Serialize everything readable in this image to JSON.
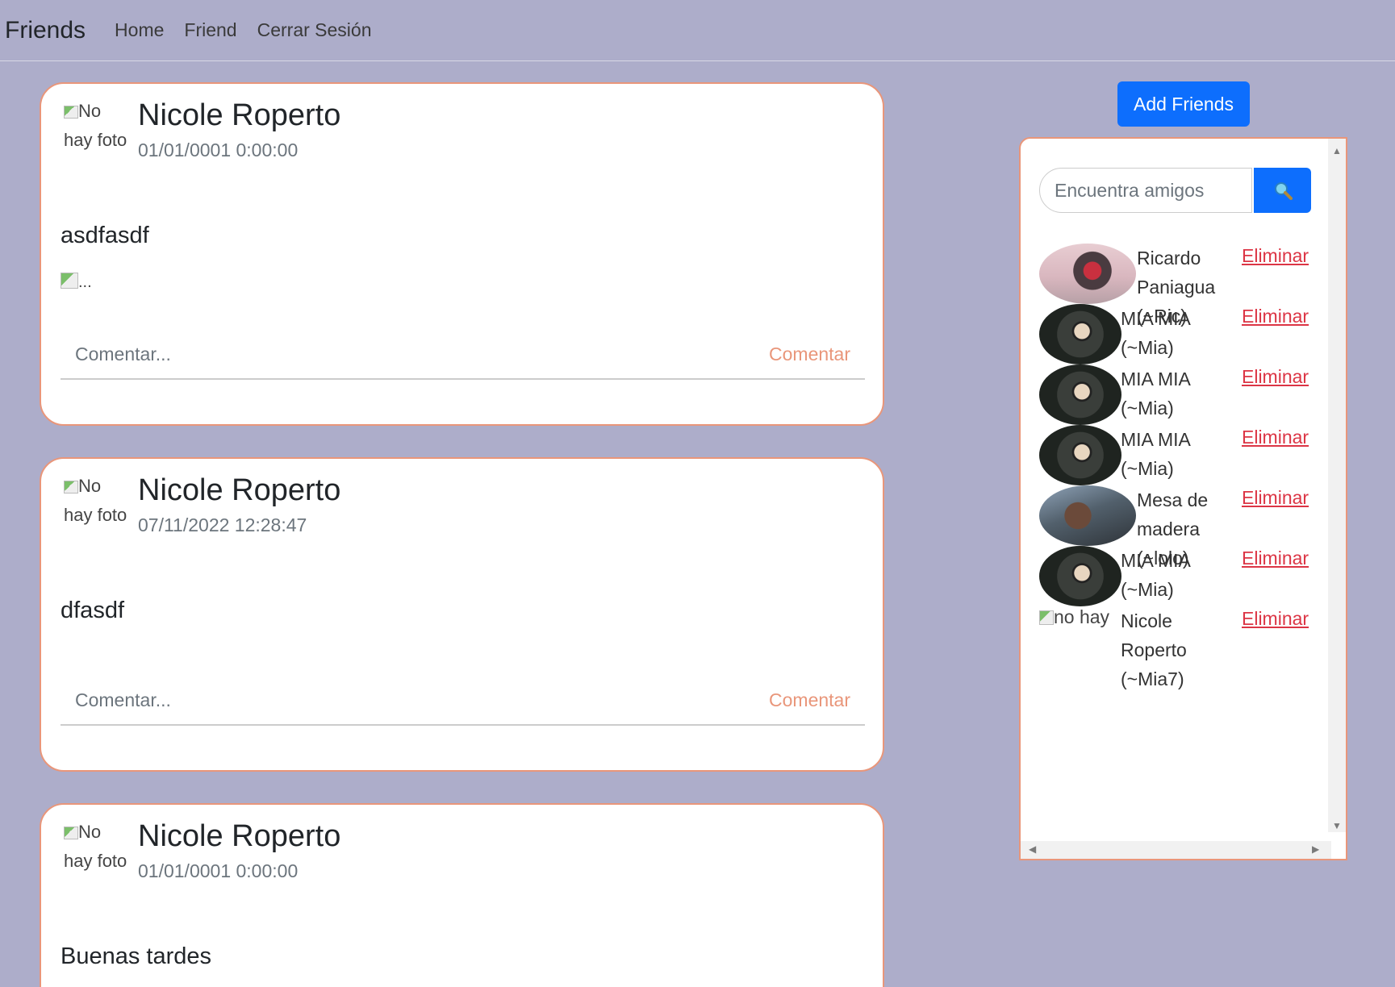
{
  "nav": {
    "brand": "Friends",
    "links": [
      "Home",
      "Friend",
      "Cerrar Sesión"
    ]
  },
  "posts": [
    {
      "avatar_alt": "No hay foto",
      "author": "Nicole Roperto",
      "date": "01/01/0001 0:00:00",
      "text": "asdfasdf",
      "image_alt": "...",
      "comment_placeholder": "Comentar...",
      "comment_button": "Comentar"
    },
    {
      "avatar_alt": "No hay foto",
      "author": "Nicole Roperto",
      "date": "07/11/2022 12:28:47",
      "text": "dfasdf",
      "comment_placeholder": "Comentar...",
      "comment_button": "Comentar"
    },
    {
      "avatar_alt": "No hay foto",
      "author": "Nicole Roperto",
      "date": "01/01/0001 0:00:00",
      "text": "Buenas tardes"
    }
  ],
  "sidebar": {
    "add_friends": "Add Friends",
    "search_placeholder": "Encuentra amigos",
    "search_icon": "magnifier-icon",
    "friends": [
      {
        "name": "Ricardo Paniagua (~Ric)",
        "remove": "Eliminar"
      },
      {
        "name": "MIA MIA (~Mia)",
        "remove": "Eliminar"
      },
      {
        "name": "MIA MIA (~Mia)",
        "remove": "Eliminar"
      },
      {
        "name": "MIA MIA (~Mia)",
        "remove": "Eliminar"
      },
      {
        "name": "Mesa de madera (~lolo)",
        "remove": "Eliminar"
      },
      {
        "name": "MIA MIA (~Mia)",
        "remove": "Eliminar"
      },
      {
        "name": "Nicole Roperto (~Mia7)",
        "remove": "Eliminar",
        "avatar_alt": "no hay"
      }
    ]
  },
  "colors": {
    "background": "#adadca",
    "accent": "#e9967a",
    "primary": "#0d6efd",
    "danger": "#dc3545"
  }
}
